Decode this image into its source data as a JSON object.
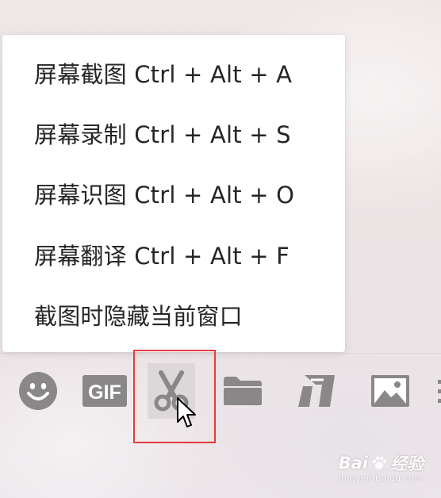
{
  "menu": {
    "items": [
      {
        "label": "屏幕截图 Ctrl + Alt + A"
      },
      {
        "label": "屏幕录制 Ctrl + Alt + S"
      },
      {
        "label": "屏幕识图 Ctrl + Alt + O"
      },
      {
        "label": "屏幕翻译 Ctrl + Alt + F"
      },
      {
        "label": "截图时隐藏当前窗口"
      }
    ]
  },
  "toolbar": {
    "icons": [
      "emoji-icon",
      "gif-icon",
      "scissors-icon",
      "folder-icon",
      "text-style-icon",
      "image-icon"
    ],
    "gif_label": "GIF",
    "active_tool": "scissors-icon"
  },
  "watermark": {
    "brand_left": "Bai",
    "brand_right": "经验",
    "url": "jingyan.baidu.com"
  },
  "colors": {
    "menu_bg": "#ffffff",
    "menu_text": "#262626",
    "icon": "#8a8788",
    "highlight": "#e53a3a"
  }
}
